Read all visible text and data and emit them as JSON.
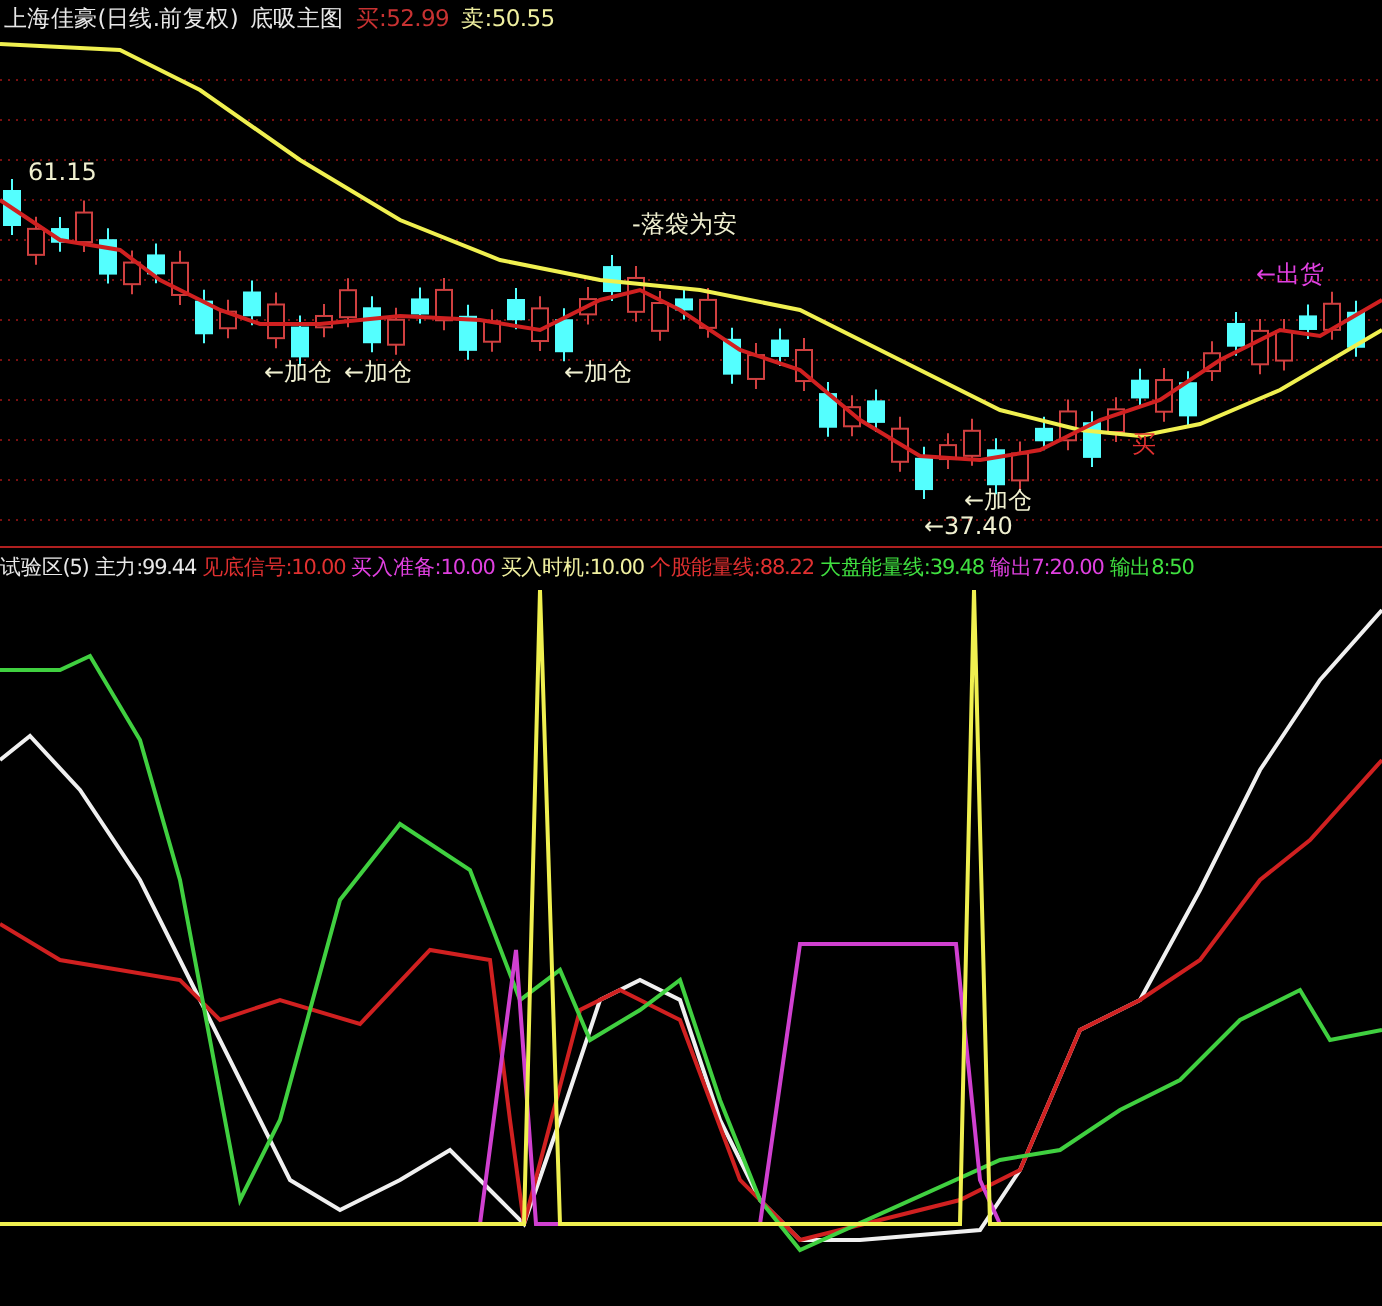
{
  "price_panel": {
    "title": "上海佳豪(日线.前复权)",
    "indicator": "底吸主图",
    "readings": [
      {
        "text": "买:52.99",
        "color": "#c83232"
      },
      {
        "text": "卖:50.55",
        "color": "#f0f0a0"
      }
    ],
    "annotations": [
      {
        "text": "61.15",
        "kind": "high"
      },
      {
        "text": "←加仓",
        "kind": "signal"
      },
      {
        "text": "←加仓",
        "kind": "signal"
      },
      {
        "text": "←加仓",
        "kind": "signal"
      },
      {
        "text": "-落袋为安",
        "kind": "signal"
      },
      {
        "text": "←加仓",
        "kind": "signal"
      },
      {
        "text": "←37.40",
        "kind": "low"
      },
      {
        "text": "买",
        "kind": "buy"
      },
      {
        "text": "←出货",
        "kind": "sell"
      }
    ]
  },
  "indicator_panel": {
    "title": "试验区(5)",
    "readings": [
      {
        "text": "主力:99.44",
        "color": "#e8e8e8"
      },
      {
        "text": "见底信号:10.00",
        "color": "#e03030"
      },
      {
        "text": "买入准备:10.00",
        "color": "#e040e0"
      },
      {
        "text": "买入时机:10.00",
        "color": "#f0f0a0"
      },
      {
        "text": "个股能量线:88.22",
        "color": "#e03030"
      },
      {
        "text": "大盘能量线:39.48",
        "color": "#40e040"
      },
      {
        "text": "输出7:20.00",
        "color": "#e040e0"
      },
      {
        "text": "输出8:50",
        "color": "#40e040"
      }
    ]
  }
}
